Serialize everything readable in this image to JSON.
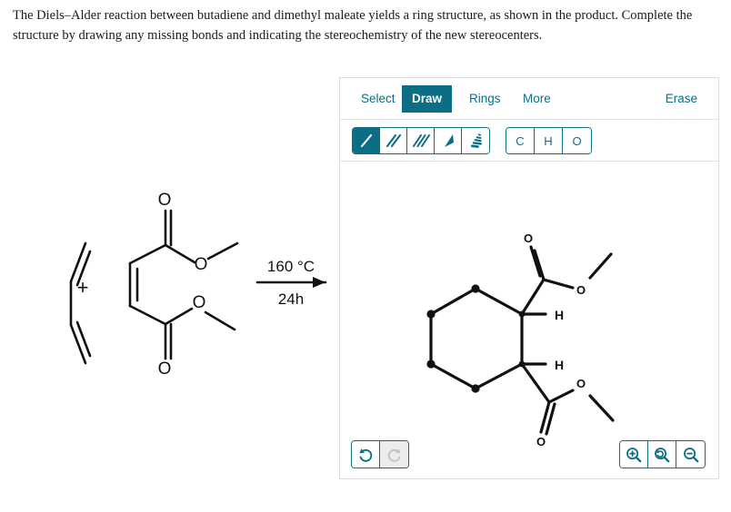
{
  "prompt": {
    "text": "The Diels–Alder reaction between butadiene and dimethyl maleate yields a ring structure, as shown in the product. Complete the structure by drawing any missing bonds and indicating the stereochemistry of the new stereocenters."
  },
  "reaction": {
    "plus": "+",
    "condition_above": "160 °C",
    "condition_below": "24h",
    "reactant1_name": "butadiene",
    "reactant2_name": "dimethyl maleate",
    "atom_labels": {
      "oxygen": "O",
      "hydrogen": "H"
    }
  },
  "editor": {
    "tabs": [
      {
        "label": "Select",
        "active": false
      },
      {
        "label": "Draw",
        "active": true
      },
      {
        "label": "Rings",
        "active": false
      },
      {
        "label": "More",
        "active": false
      }
    ],
    "erase_label": "Erase",
    "bond_tools": [
      {
        "name": "single-bond",
        "active": true
      },
      {
        "name": "double-bond",
        "active": false
      },
      {
        "name": "triple-bond",
        "active": false
      },
      {
        "name": "wedge-bond",
        "active": false
      },
      {
        "name": "hash-bond",
        "active": false
      }
    ],
    "atom_tools": [
      {
        "label": "C"
      },
      {
        "label": "H"
      },
      {
        "label": "O"
      }
    ],
    "history": [
      {
        "name": "undo",
        "enabled": true
      },
      {
        "name": "redo",
        "enabled": false
      }
    ],
    "zoom_controls": [
      {
        "name": "zoom-in"
      },
      {
        "name": "zoom-reset"
      },
      {
        "name": "zoom-out"
      }
    ],
    "product_labels": {
      "h_upper": "H",
      "h_lower": "H",
      "o_carbonyl_upper": "O",
      "o_ester_upper": "O",
      "o_ester_lower": "O",
      "o_carbonyl_lower": "O"
    }
  },
  "colors": {
    "accent": "#0b6e85",
    "structure": "#111111",
    "panel_border": "#dcdcdc",
    "disabled": "#bcc5c9"
  }
}
